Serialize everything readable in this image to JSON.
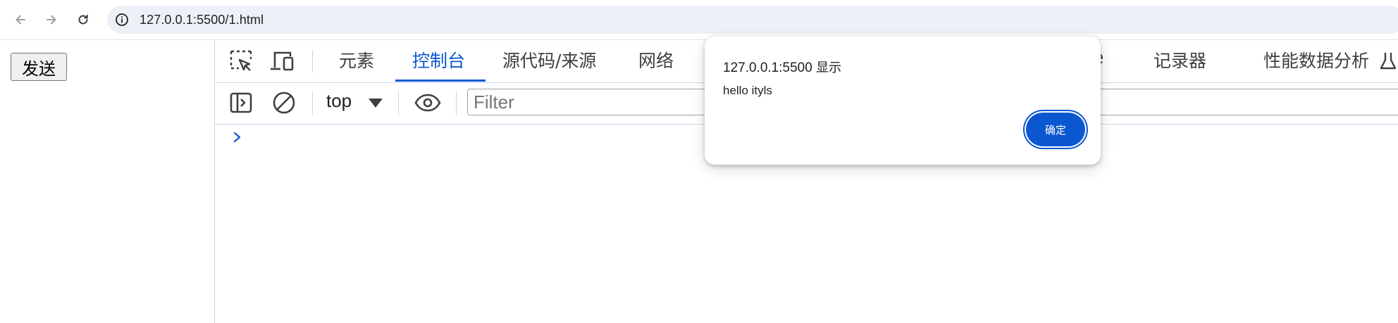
{
  "browser": {
    "back_icon": "arrow-left-icon",
    "forward_icon": "arrow-right-icon",
    "reload_icon": "reload-icon",
    "site_info_icon": "info-icon",
    "url": "127.0.0.1:5500/1.html"
  },
  "page": {
    "send_label": "发送"
  },
  "devtools": {
    "tabs": [
      {
        "label": "元素",
        "active": false
      },
      {
        "label": "控制台",
        "active": true
      },
      {
        "label": "源代码/来源",
        "active": false
      },
      {
        "label": "网络",
        "active": false
      },
      {
        "label": "se",
        "active": false
      },
      {
        "label": "记录器",
        "active": false
      },
      {
        "label": "性能数据分析",
        "active": false
      }
    ],
    "toolbar": {
      "context": "top",
      "filter_placeholder": "Filter"
    },
    "accent_color": "#0b57d0"
  },
  "alert": {
    "origin": "127.0.0.1:5500",
    "origin_suffix": "显示",
    "message": "hello ityls",
    "ok_label": "确定"
  }
}
